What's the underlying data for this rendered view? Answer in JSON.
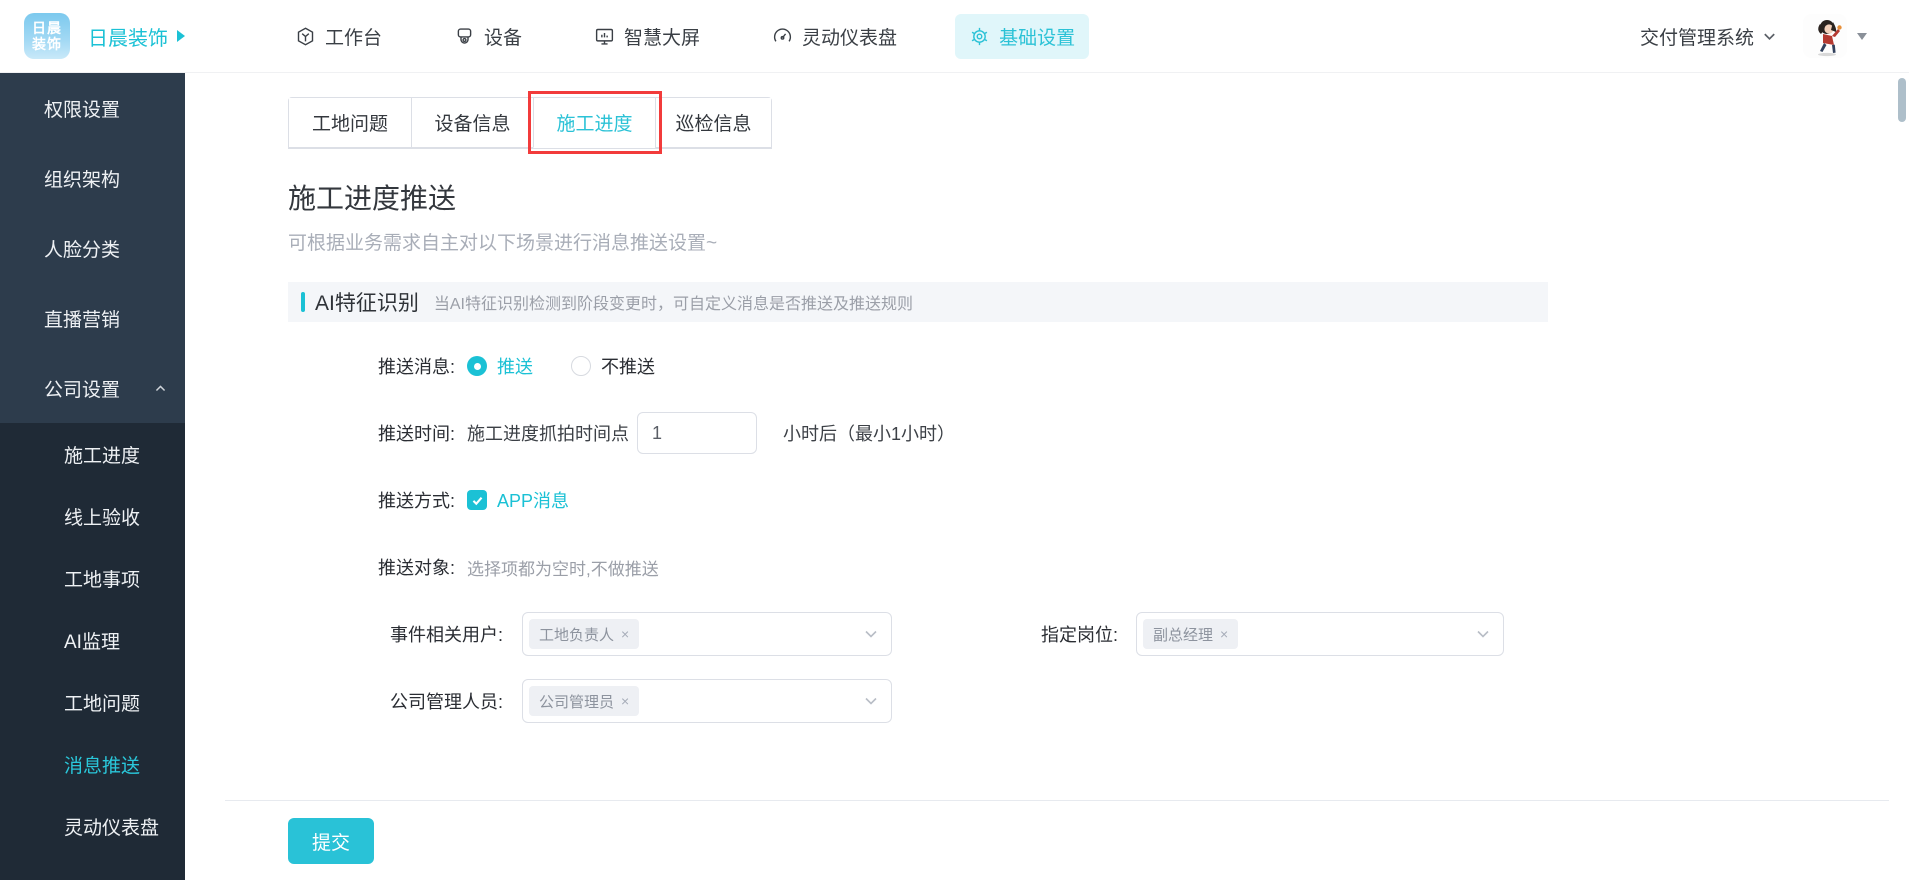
{
  "navbar": {
    "logo": {
      "line1": "日晨",
      "line2": "装饰"
    },
    "brand": "日晨装饰",
    "items": [
      {
        "label": "工作台",
        "icon": "workbench-icon",
        "active": false
      },
      {
        "label": "设备",
        "icon": "camera-icon",
        "active": false
      },
      {
        "label": "智慧大屏",
        "icon": "big-screen-icon",
        "active": false
      },
      {
        "label": "灵动仪表盘",
        "icon": "dashboard-icon",
        "active": false
      },
      {
        "label": "基础设置",
        "icon": "gear-icon",
        "active": true
      }
    ],
    "system_switcher": "交付管理系统"
  },
  "sidebar": {
    "items": [
      {
        "label": "权限设置"
      },
      {
        "label": "组织架构"
      },
      {
        "label": "人脸分类"
      },
      {
        "label": "直播营销"
      },
      {
        "label": "公司设置",
        "expanded": true
      }
    ],
    "subitems": [
      {
        "label": "施工进度",
        "active": false
      },
      {
        "label": "线上验收",
        "active": false
      },
      {
        "label": "工地事项",
        "active": false
      },
      {
        "label": "AI监理",
        "active": false
      },
      {
        "label": "工地问题",
        "active": false
      },
      {
        "label": "消息推送",
        "active": true
      },
      {
        "label": "灵动仪表盘",
        "active": false
      }
    ]
  },
  "main": {
    "tabs": [
      {
        "label": "工地问题",
        "active": false
      },
      {
        "label": "设备信息",
        "active": false
      },
      {
        "label": "施工进度",
        "active": true,
        "annotated": true
      },
      {
        "label": "巡检信息",
        "active": false
      }
    ],
    "title": "施工进度推送",
    "subtitle": "可根据业务需求自主对以下场景进行消息推送设置~",
    "section": {
      "title": "AI特征识别",
      "hint": "当AI特征识别检测到阶段变更时，可自定义消息是否推送及推送规则"
    },
    "form": {
      "push_message": {
        "label": "推送消息:",
        "options": [
          {
            "label": "推送",
            "selected": true
          },
          {
            "label": "不推送",
            "selected": false
          }
        ]
      },
      "push_time": {
        "label": "推送时间:",
        "prefix": "施工进度抓拍时间点",
        "value": "1",
        "suffix": "小时后（最小1小时）"
      },
      "push_method": {
        "label": "推送方式:",
        "option": "APP消息",
        "checked": true
      },
      "push_target": {
        "label": "推送对象:",
        "hint": "选择项都为空时,不做推送"
      },
      "related_user": {
        "label": "事件相关用户:",
        "tag": "工地负责人",
        "close": "×"
      },
      "assigned_position": {
        "label": "指定岗位:",
        "tag": "副总经理",
        "close": "×"
      },
      "company_admin": {
        "label": "公司管理人员:",
        "tag": "公司管理员",
        "close": "×"
      }
    },
    "submit_label": "提交"
  },
  "colors": {
    "accent": "#1bc1d5",
    "accent_bg": "#e0f6fa",
    "sidebar_bg": "#2d3c4c",
    "submenu_bg": "#1f2a36",
    "annotation_red": "#f23b3b",
    "section_bg": "#f4f6f9"
  }
}
